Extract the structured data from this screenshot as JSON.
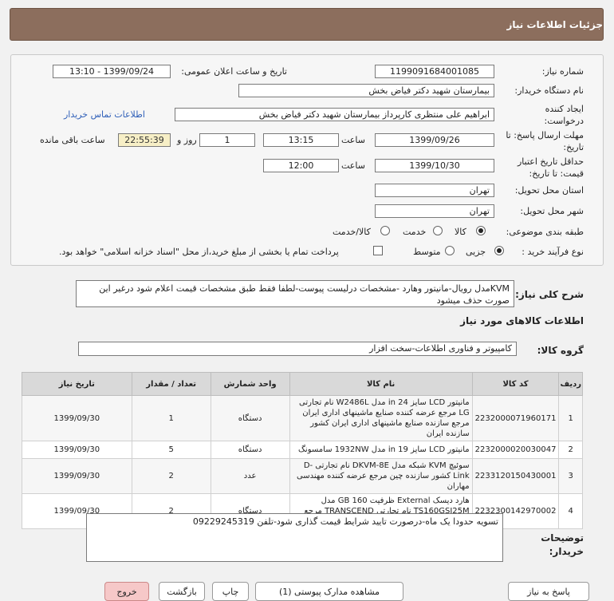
{
  "header": {
    "title": "جزئیات اطلاعات نیاز"
  },
  "info": {
    "need_number_label": "شماره نیاز:",
    "need_number": "1199091684001085",
    "announce_label": "تاریخ و ساعت اعلان عمومی:",
    "announce_value": "1399/09/24 - 13:10",
    "buyer_org_label": "نام دستگاه خریدار:",
    "buyer_org": "بیمارستان شهید دکتر فیاض بخش",
    "creator_label": "ایجاد کننده درخواست:",
    "creator": "ابراهیم علی منتظری کارپرداز بیمارستان شهید دکتر فیاض بخش",
    "contact_link": "اطلاعات تماس خریدار",
    "reply_deadline_label": "مهلت ارسال پاسخ: تا تاریخ:",
    "reply_date": "1399/09/26",
    "time_label": "ساعت",
    "reply_time": "13:15",
    "days": "1",
    "days_label": "روز و",
    "remaining": "22:55:39",
    "remaining_label": "ساعت باقی مانده",
    "validity_label": "حداقل تاریخ اعتبار قیمت: تا تاریخ:",
    "validity_date": "1399/10/30",
    "validity_time": "12:00",
    "province_label": "استان محل تحویل:",
    "province": "تهران",
    "city_label": "شهر محل تحویل:",
    "city": "تهران",
    "category_label": "طبقه بندی موضوعی:",
    "cat_goods": "کالا",
    "cat_service": "خدمت",
    "cat_goods_service": "کالا/خدمت",
    "process_label": "نوع فرآیند خرید :",
    "proc_minor": "جزیی",
    "proc_medium": "متوسط",
    "payment_note": "پرداخت تمام یا بخشی از مبلغ خرید،از محل \"اسناد خزانه اسلامی\" خواهد بود."
  },
  "summary": {
    "label": "شرح کلی نیاز:",
    "text": "KVMمدل رویال-مانیتور وهارد -مشخصات درلیست پیوست-لطفا فقط طبق مشخصات قیمت اعلام شود درغیر این صورت حذف میشود"
  },
  "goods_section": {
    "title": "اطلاعات کالاهای مورد نیاز"
  },
  "group": {
    "label": "گروه کالا:",
    "value": "کامپیوتر و فناوری اطلاعات-سخت افزار"
  },
  "table": {
    "headers": [
      "ردیف",
      "کد کالا",
      "نام کالا",
      "واحد شمارش",
      "تعداد / مقدار",
      "تاریخ نیاز"
    ],
    "rows": [
      [
        "1",
        "2232000071960171",
        "مانیتور LCD سایز 24 in مدل W2486L نام تجارتی LG مرجع عرضه کننده صنایع ماشینهای اداری ایران مرجع سازنده صنایع ماشینهای اداری ایران کشور سازنده ایران",
        "دستگاه",
        "1",
        "1399/09/30"
      ],
      [
        "2",
        "2232000020030047",
        "مانیتور LCD سایز 19 in مدل 1932NW سامسونگ",
        "دستگاه",
        "5",
        "1399/09/30"
      ],
      [
        "3",
        "2233120150430001",
        "سوئیچ KVM شبکه مدل DKVM-8E نام تجارتی D-Link کشور سازنده چین مرجع عرضه کننده مهندسی مهاران",
        "عدد",
        "2",
        "1399/09/30"
      ],
      [
        "4",
        "2232300142970002",
        "هارد دیسک External ظرفیت 160 GB مدل TS160GSJ25M نام تجارتی TRANSCEND مرجع عرضه کننده بازرگانی تجهیز رایانه مرات",
        "دستگاه",
        "2",
        "1399/09/30"
      ]
    ]
  },
  "buyer_notes": {
    "label": "توضیحات خریدار:",
    "text": "تسویه حدودا یک ماه-درصورت تایید شرایط قیمت گذاری شود-تلفن 09229245319"
  },
  "buttons": {
    "reply": "پاسخ به نیاز",
    "docs": "مشاهده مدارک پیوستی (1)",
    "print": "چاپ",
    "back": "بازگشت",
    "exit": "خروج"
  }
}
